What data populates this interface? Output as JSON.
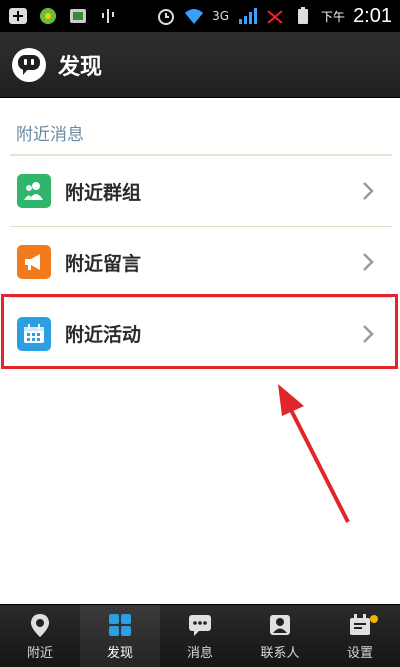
{
  "status_bar": {
    "network": "3G",
    "ampm": "下午",
    "time": "2:01",
    "icons": [
      "plus-icon",
      "clover-icon",
      "sd-icon",
      "usb-icon",
      "alarm-icon",
      "wifi-icon",
      "signal-icon",
      "sim-icon",
      "battery-icon"
    ]
  },
  "header": {
    "title": "发现",
    "icon": "chat-bubble-icon"
  },
  "section": {
    "title": "附近消息"
  },
  "items": [
    {
      "label": "附近群组",
      "icon": "group-icon",
      "color": "#2fb66b"
    },
    {
      "label": "附近留言",
      "icon": "megaphone-icon",
      "color": "#f07a1c"
    },
    {
      "label": "附近活动",
      "icon": "calendar-icon",
      "color": "#2a9fe1"
    }
  ],
  "annotation": {
    "highlight_color": "#e2252a"
  },
  "tabbar": {
    "tabs": [
      {
        "label": "附近",
        "icon": "location-pin-icon"
      },
      {
        "label": "发现",
        "icon": "grid-icon"
      },
      {
        "label": "消息",
        "icon": "message-icon"
      },
      {
        "label": "联系人",
        "icon": "contacts-icon"
      },
      {
        "label": "设置",
        "icon": "settings-icon"
      }
    ]
  }
}
